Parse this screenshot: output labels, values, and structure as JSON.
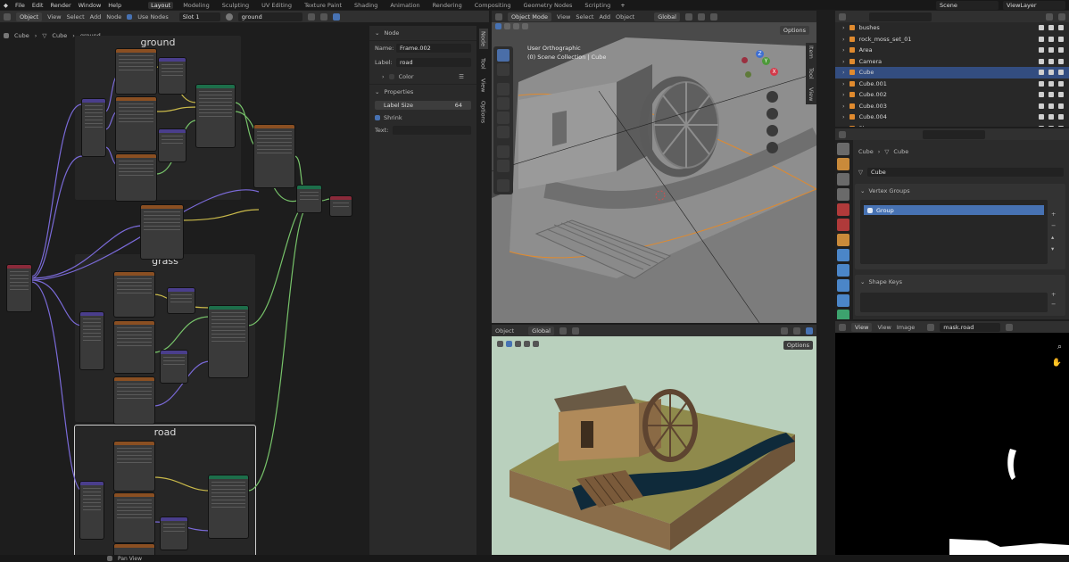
{
  "menu": [
    "File",
    "Edit",
    "Render",
    "Window",
    "Help"
  ],
  "workspaces": {
    "tabs": [
      "Layout",
      "Modeling",
      "Sculpting",
      "UV Editing",
      "Texture Paint",
      "Shading",
      "Animation",
      "Rendering",
      "Compositing",
      "Geometry Nodes",
      "Scripting"
    ],
    "active": "Layout"
  },
  "scene": {
    "name": "Scene",
    "view_layer": "ViewLayer"
  },
  "node_editor": {
    "mode": "Object",
    "menus": [
      "View",
      "Select",
      "Add",
      "Node"
    ],
    "use_nodes_label": "Use Nodes",
    "slot": "Slot 1",
    "material": "ground",
    "breadcrumb": [
      "Cube",
      "Cube",
      "ground"
    ],
    "frames": [
      "ground",
      "grass",
      "road"
    ],
    "sidebar_tabs": [
      "Node",
      "Tool",
      "View",
      "Options"
    ],
    "panel": {
      "node_header": "Node",
      "name_label": "Name:",
      "name_value": "Frame.002",
      "label_label": "Label:",
      "label_value": "road",
      "color_label": "Color",
      "properties_header": "Properties",
      "label_size_label": "Label Size",
      "label_size_value": "64",
      "shrink_label": "Shrink",
      "shrink_checked": true,
      "text_label": "Text:"
    }
  },
  "viewport": {
    "mode": "Object Mode",
    "menus": [
      "View",
      "Select",
      "Add",
      "Object"
    ],
    "transform": "Global",
    "options": "Options",
    "info_line1": "User Orthographic",
    "info_line2": "(0) Scene Collection | Cube",
    "sidebar_tabs": [
      "Item",
      "Tool",
      "View"
    ],
    "gizmo": {
      "x": "X",
      "y": "Y",
      "z": "Z"
    }
  },
  "render_view": {
    "mode": "Object",
    "transform": "Global",
    "options": "Options"
  },
  "outliner": {
    "rows": [
      {
        "name": "bushes",
        "selected": false
      },
      {
        "name": "rock_moss_set_01",
        "selected": false
      },
      {
        "name": "Area",
        "selected": false
      },
      {
        "name": "Camera",
        "selected": false
      },
      {
        "name": "Cube",
        "selected": true
      },
      {
        "name": "Cube.001",
        "selected": false
      },
      {
        "name": "Cube.002",
        "selected": false
      },
      {
        "name": "Cube.003",
        "selected": false
      },
      {
        "name": "Cube.004",
        "selected": false
      },
      {
        "name": "Plane",
        "selected": false
      }
    ]
  },
  "properties": {
    "breadcrumb": [
      "Cube",
      "Cube"
    ],
    "mesh_name": "Cube",
    "vertex_groups_header": "Vertex Groups",
    "vertex_group_item": "Group",
    "shape_keys_header": "Shape Keys"
  },
  "image_editor": {
    "menus": [
      "View",
      "View",
      "Image"
    ],
    "image_name": "mask.road"
  },
  "status_bar": {
    "hint": "Pan View"
  },
  "colors": {
    "accent": "#4772b3",
    "selection": "#334d80",
    "frame_bg": "#262626",
    "shader_node_header": "#1d6e4a",
    "texture_node_header": "#8a4f22",
    "vector_node_header": "#4a3e8c",
    "wire_purple": "#7a6ad8",
    "wire_green": "#77c36a",
    "wire_yellow": "#c9b94a",
    "render_bg": "#b9d0bd"
  },
  "icons": {
    "object_types": [
      "light-icon",
      "camera-icon",
      "mesh-icon"
    ],
    "properties_tabs": [
      "tool-icon",
      "render-icon",
      "output-icon",
      "view-layer-icon",
      "scene-icon",
      "world-icon",
      "object-icon",
      "modifier-icon",
      "particles-icon",
      "physics-icon",
      "constraints-icon",
      "data-icon"
    ]
  }
}
